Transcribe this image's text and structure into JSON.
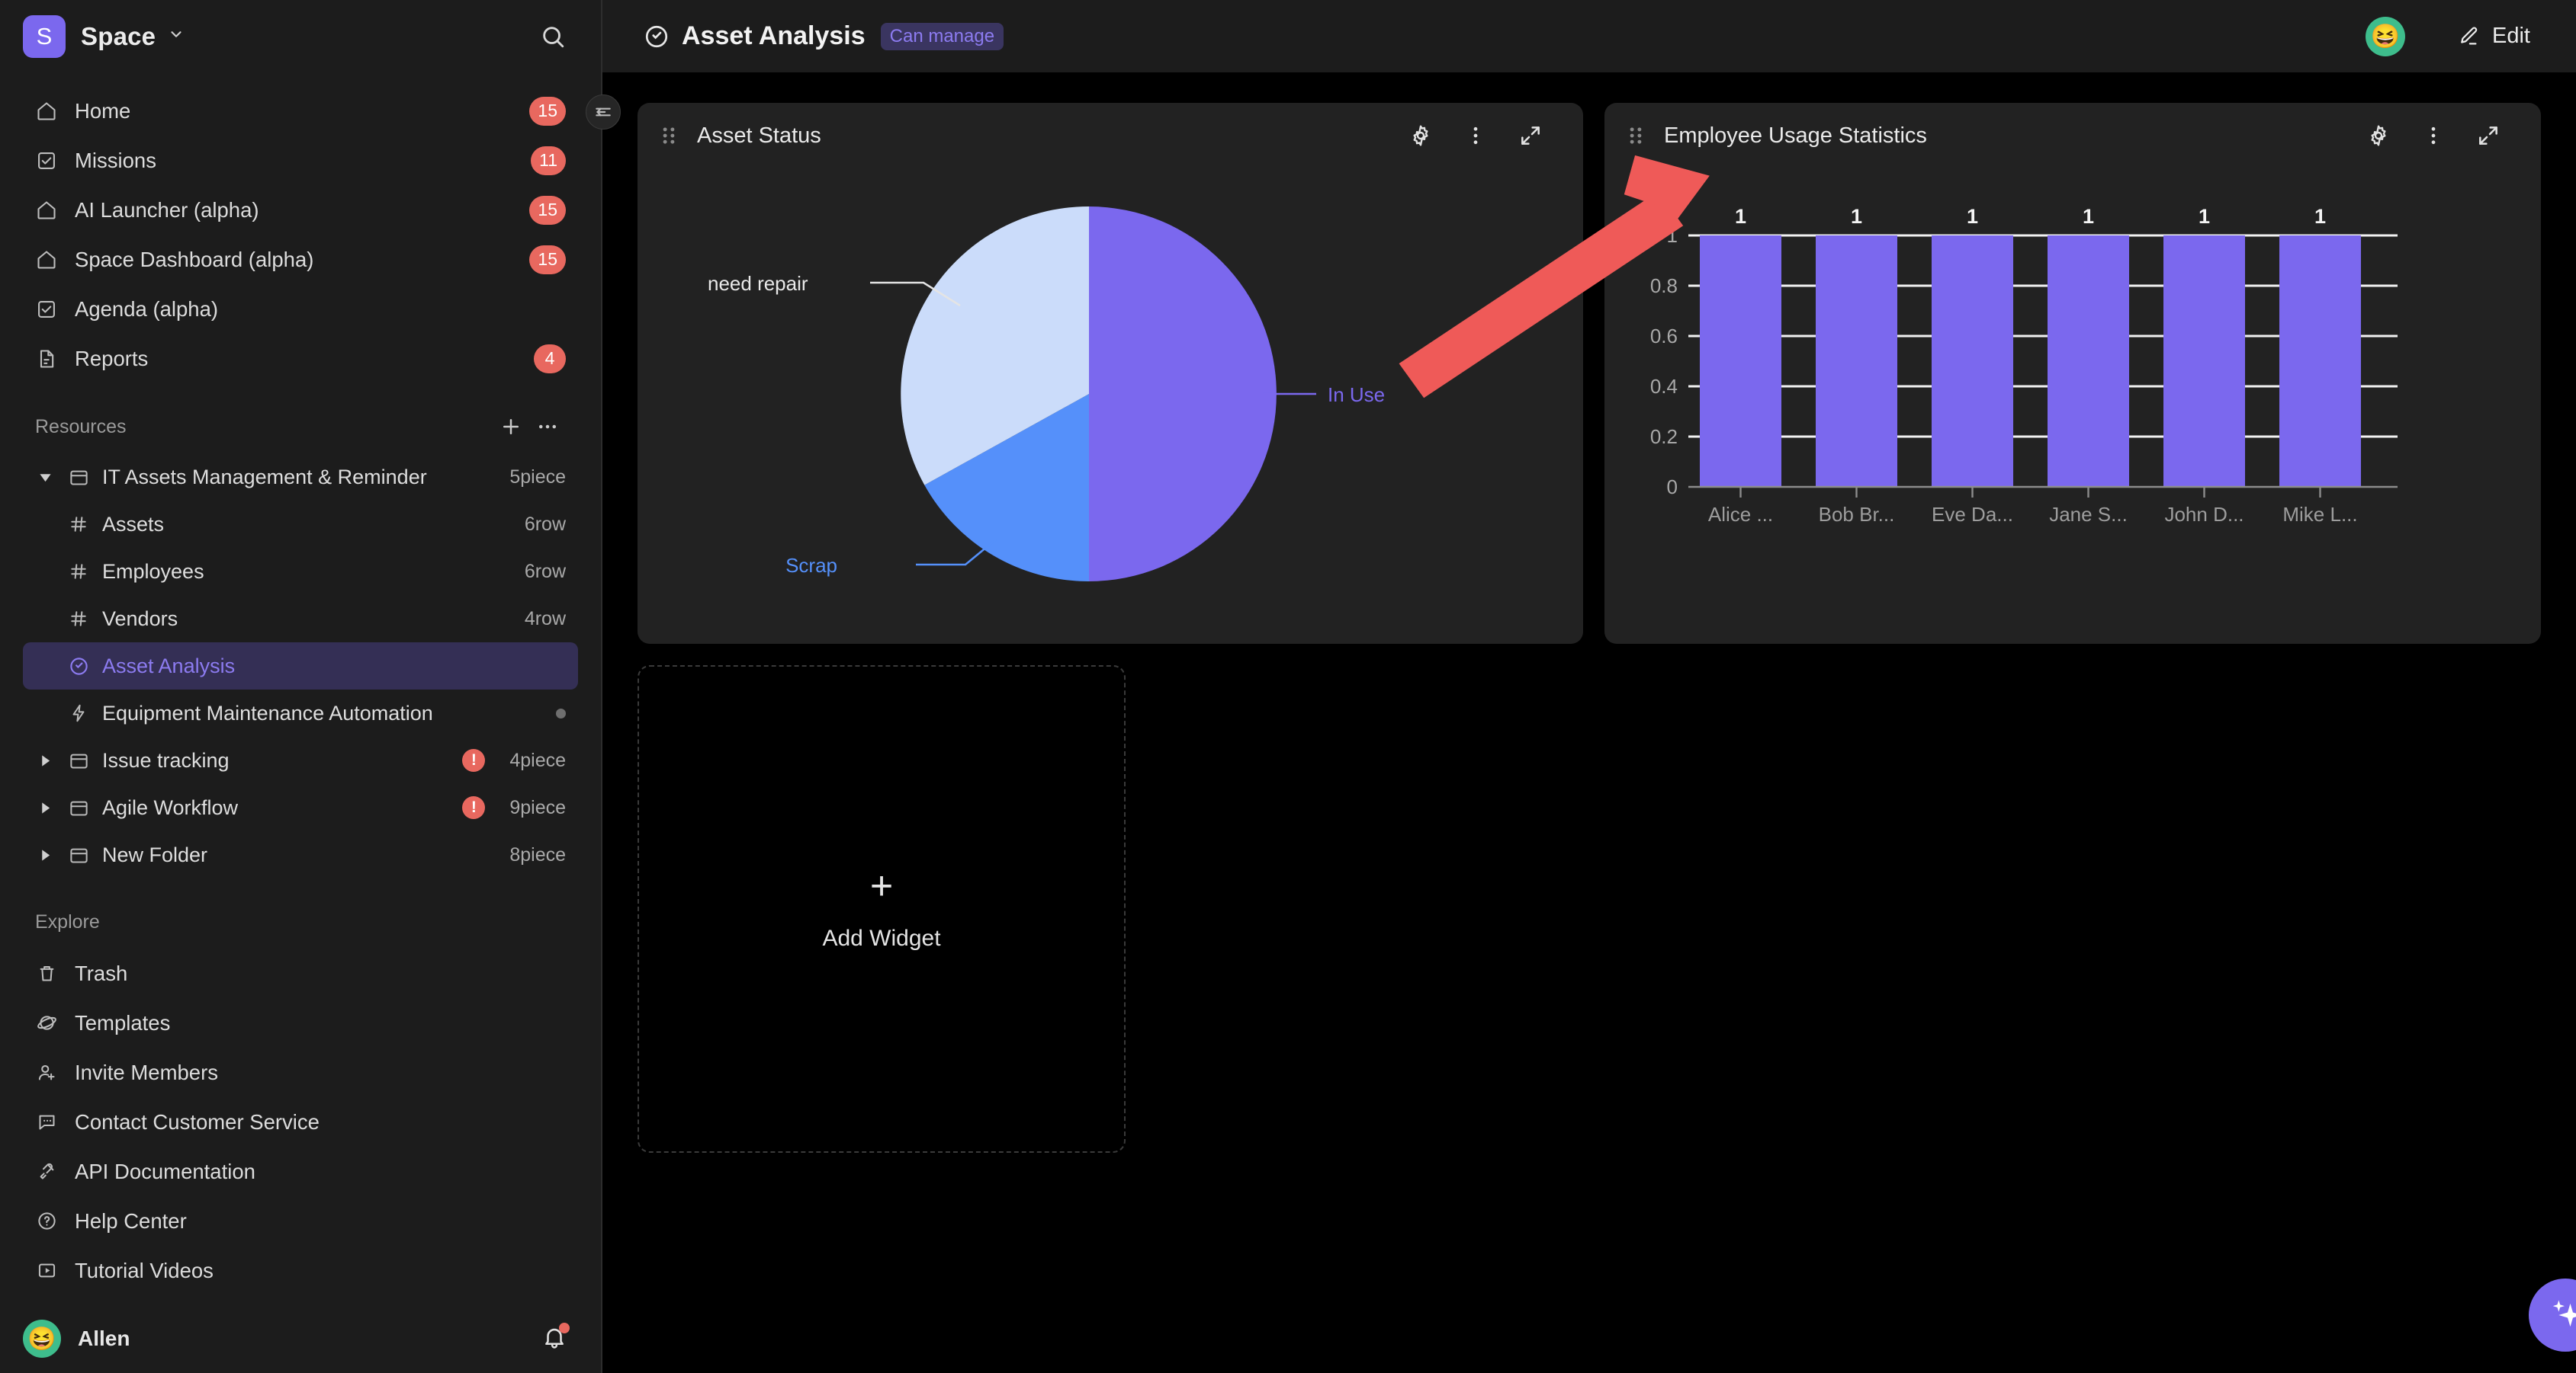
{
  "sidebar": {
    "workspace": {
      "initial": "S",
      "name": "Space",
      "chevron": "chevron-down-icon",
      "search_icon": "search-icon"
    },
    "nav": [
      {
        "label": "Home",
        "icon": "home-icon",
        "badge": "15"
      },
      {
        "label": "Missions",
        "icon": "checkbox-icon",
        "badge": "11"
      },
      {
        "label": "AI Launcher (alpha)",
        "icon": "home-icon",
        "badge": "15"
      },
      {
        "label": "Space Dashboard (alpha)",
        "icon": "home-icon",
        "badge": "15"
      },
      {
        "label": "Agenda (alpha)",
        "icon": "checkbox-icon",
        "badge": ""
      },
      {
        "label": "Reports",
        "icon": "document-icon",
        "badge": "4"
      }
    ],
    "resources": {
      "title": "Resources",
      "add_label": "+",
      "more_label": "•••",
      "items": [
        {
          "label": "IT Assets Management & Reminder",
          "icon": "folder-icon",
          "meta": "5piece",
          "twisty": "expanded",
          "level": 0,
          "selected": false,
          "warn": false
        },
        {
          "label": "Assets",
          "icon": "table-icon",
          "meta": "6row",
          "twisty": "",
          "level": 1,
          "selected": false,
          "warn": false
        },
        {
          "label": "Employees",
          "icon": "table-icon",
          "meta": "6row",
          "twisty": "",
          "level": 1,
          "selected": false,
          "warn": false
        },
        {
          "label": "Vendors",
          "icon": "table-icon",
          "meta": "4row",
          "twisty": "",
          "level": 1,
          "selected": false,
          "warn": false
        },
        {
          "label": "Asset Analysis",
          "icon": "dashboard-icon",
          "meta": "",
          "twisty": "",
          "level": 1,
          "selected": true,
          "warn": false
        },
        {
          "label": "Equipment Maintenance Automation",
          "icon": "bolt-icon",
          "meta": "",
          "twisty": "",
          "level": 1,
          "selected": false,
          "warn": false,
          "dot": true
        },
        {
          "label": "Issue tracking",
          "icon": "folder-icon",
          "meta": "4piece",
          "twisty": "collapsed",
          "level": 0,
          "selected": false,
          "warn": true
        },
        {
          "label": "Agile Workflow",
          "icon": "folder-icon",
          "meta": "9piece",
          "twisty": "collapsed",
          "level": 0,
          "selected": false,
          "warn": true
        },
        {
          "label": "New Folder",
          "icon": "folder-icon",
          "meta": "8piece",
          "twisty": "collapsed",
          "level": 0,
          "selected": false,
          "warn": false
        }
      ]
    },
    "explore": {
      "title": "Explore",
      "items": [
        {
          "label": "Trash",
          "icon": "trash-icon"
        },
        {
          "label": "Templates",
          "icon": "planet-icon"
        },
        {
          "label": "Invite Members",
          "icon": "user-plus-icon"
        },
        {
          "label": "Contact Customer Service",
          "icon": "chat-icon"
        },
        {
          "label": "API Documentation",
          "icon": "plug-icon"
        },
        {
          "label": "Help Center",
          "icon": "question-circle-icon"
        },
        {
          "label": "Tutorial Videos",
          "icon": "video-icon"
        }
      ]
    },
    "user": {
      "name": "Allen",
      "avatar_emoji": "😆",
      "bell_icon": "bell-icon",
      "has_notification": true
    },
    "collapse_icon": "collapse-sidebar-icon"
  },
  "topbar": {
    "page_icon": "dashboard-icon",
    "title": "Asset Analysis",
    "permission": "Can manage",
    "avatar_emoji": "😆",
    "edit_label": "Edit",
    "edit_icon": "pencil-icon"
  },
  "widgets": {
    "pie_widget": {
      "title": "Asset Status",
      "drag_icon": "drag-handle-icon",
      "settings_icon": "gear-icon",
      "more_icon": "more-vertical-icon",
      "expand_icon": "expand-icon"
    },
    "bar_widget": {
      "title": "Employee Usage Statistics",
      "drag_icon": "drag-handle-icon",
      "settings_icon": "gear-icon",
      "more_icon": "more-vertical-icon",
      "expand_icon": "expand-icon"
    },
    "add_widget": {
      "label": "Add Widget",
      "plus": "+"
    }
  },
  "ai_fab": {
    "icon": "sparkle-icon"
  },
  "colors": {
    "accent": "#7b68ee",
    "pie_in_use": "#7b68ee",
    "pie_need_repair": "#cbdcfa",
    "pie_scrap": "#5590fa",
    "badge_red": "#e8685f",
    "annotation_red": "#ef5a58",
    "widget_bg": "#222222",
    "sidebar_bg": "#1c1c1c",
    "canvas_bg": "#000000"
  },
  "chart_data": [
    {
      "type": "pie",
      "title": "Asset Status",
      "labels": [
        "In Use",
        "need repair",
        "Scrap"
      ],
      "values": [
        50,
        33,
        17
      ],
      "colors": [
        "#7b68ee",
        "#cbdcfa",
        "#5590fa"
      ],
      "legend": "labels-outside-with-leader-lines",
      "label_colors": [
        "#7b68ee",
        "#e9e9e9",
        "#5590fa"
      ]
    },
    {
      "type": "bar",
      "title": "Employee Usage Statistics",
      "categories": [
        "Alice ...",
        "Bob Br...",
        "Eve Da...",
        "Jane S...",
        "John D...",
        "Mike L..."
      ],
      "values": [
        1,
        1,
        1,
        1,
        1,
        1
      ],
      "data_labels": [
        "1",
        "1",
        "1",
        "1",
        "1",
        "1"
      ],
      "yticks": [
        "0",
        "0.2",
        "0.4",
        "0.6",
        "0.8",
        "1"
      ],
      "ylim": [
        0,
        1
      ],
      "xlabel": "",
      "ylabel": "",
      "grid": true,
      "bar_color": "#7b68ee"
    }
  ]
}
